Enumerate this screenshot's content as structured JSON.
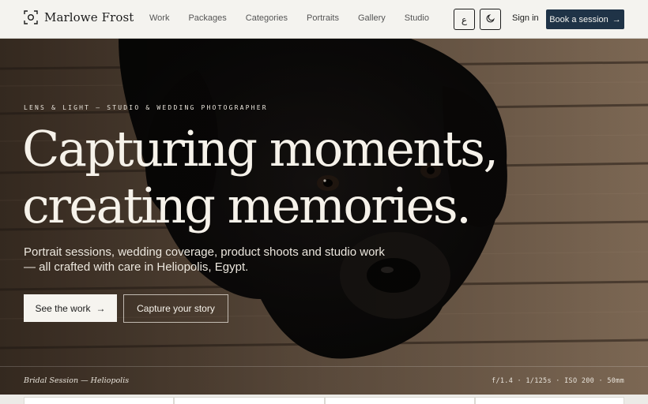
{
  "brand": {
    "name": "Marlowe Frost",
    "icon": "camera-frame-icon"
  },
  "nav": {
    "items": [
      "Work",
      "Packages",
      "Categories",
      "Portraits",
      "Gallery",
      "Studio"
    ]
  },
  "header_actions": {
    "language_label": "ع",
    "theme_icon": "moon-icon",
    "signin_label": "Sign in",
    "book_label": "Book a session",
    "book_icon": "arrow-right-icon"
  },
  "hero": {
    "eyebrow": "LENS & LIGHT — STUDIO & WEDDING PHOTOGRAPHER",
    "headline_line1": "Capturing moments,",
    "headline_line2": "creating memories.",
    "subtitle": "Portrait sessions, wedding coverage, product shoots and studio work — all crafted with care in Heliopolis, Egypt.",
    "primary_button": "See the work",
    "secondary_button": "Capture your story",
    "caption": "Bridal Session — Heliopolis",
    "exif": "f/1.4 · 1/125s · ISO 200 · 50mm"
  },
  "colors": {
    "accent": "#1f3347",
    "header_bg": "#f4f3ef",
    "hero_text": "#f6f2ea"
  }
}
